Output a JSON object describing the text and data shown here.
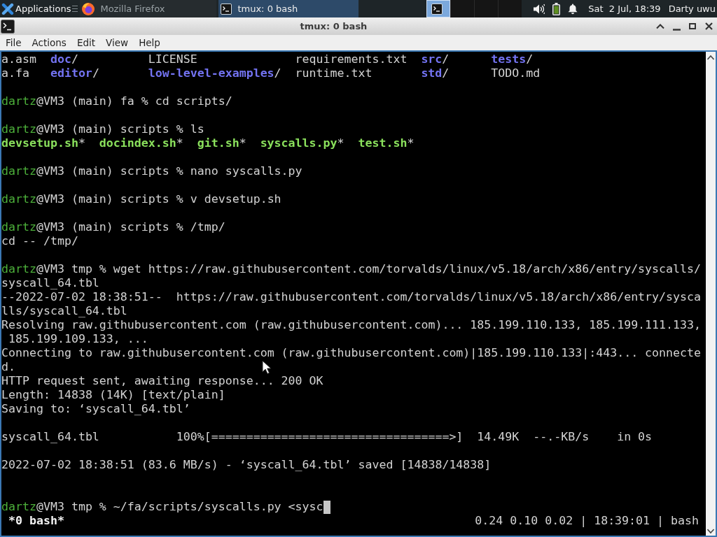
{
  "taskbar": {
    "app_menu": {
      "label": "Applications"
    },
    "tasks": [
      {
        "label": "Mozilla Firefox",
        "kind": "browser",
        "selected": false
      },
      {
        "label": "tmux: 0 bash",
        "kind": "terminal",
        "selected": true
      }
    ],
    "workspaces": [
      {
        "selected": true,
        "has_window": true
      },
      {
        "selected": false,
        "has_window": false
      },
      {
        "selected": false,
        "has_window": false
      },
      {
        "selected": false,
        "has_window": false
      }
    ],
    "clock": "Sat  2 Jul, 18:39",
    "user": "Darty uwu"
  },
  "window": {
    "title": "tmux: 0 bash",
    "menu": [
      "File",
      "Actions",
      "Edit",
      "View",
      "Help"
    ]
  },
  "terminal": {
    "lines": [
      {
        "kind": "listing",
        "rows": [
          [
            {
              "name": "a.asm",
              "kind": "file"
            },
            {
              "name": "doc",
              "kind": "dir",
              "suffix": "/"
            },
            {
              "name": "LICENSE",
              "kind": "file"
            },
            {
              "name": "requirements.txt",
              "kind": "file"
            },
            {
              "name": "src",
              "kind": "dir",
              "suffix": "/"
            },
            {
              "name": "tests",
              "kind": "dir",
              "suffix": "/"
            }
          ],
          [
            {
              "name": "a.fa",
              "kind": "file"
            },
            {
              "name": "editor",
              "kind": "dir",
              "suffix": "/"
            },
            {
              "name": "low-level-examples",
              "kind": "dir",
              "suffix": "/"
            },
            {
              "name": "runtime.txt",
              "kind": "file"
            },
            {
              "name": "std",
              "kind": "dir",
              "suffix": "/"
            },
            {
              "name": "TODO.md",
              "kind": "file"
            }
          ]
        ]
      },
      {
        "kind": "blank"
      },
      {
        "kind": "prompt",
        "user": "dartz",
        "text": "@VM3 (main) fa % cd scripts/"
      },
      {
        "kind": "blank"
      },
      {
        "kind": "prompt",
        "user": "dartz",
        "text": "@VM3 (main) scripts % ls"
      },
      {
        "kind": "listing",
        "rows": [
          [
            {
              "name": "devsetup.sh",
              "kind": "exec",
              "suffix": "*"
            },
            {
              "name": "docindex.sh",
              "kind": "exec",
              "suffix": "*"
            },
            {
              "name": "git.sh",
              "kind": "exec",
              "suffix": "*"
            },
            {
              "name": "syscalls.py",
              "kind": "exec",
              "suffix": "*"
            },
            {
              "name": "test.sh",
              "kind": "exec",
              "suffix": "*"
            }
          ]
        ]
      },
      {
        "kind": "blank"
      },
      {
        "kind": "prompt",
        "user": "dartz",
        "text": "@VM3 (main) scripts % nano syscalls.py"
      },
      {
        "kind": "blank"
      },
      {
        "kind": "prompt",
        "user": "dartz",
        "text": "@VM3 (main) scripts % v devsetup.sh"
      },
      {
        "kind": "blank"
      },
      {
        "kind": "prompt",
        "user": "dartz",
        "text": "@VM3 (main) scripts % /tmp/"
      },
      {
        "kind": "output",
        "text": "cd -- /tmp/"
      },
      {
        "kind": "blank"
      },
      {
        "kind": "prompt",
        "user": "dartz",
        "text": "@VM3 tmp % wget https://raw.githubusercontent.com/torvalds/linux/v5.18/arch/x86/entry/syscalls/"
      },
      {
        "kind": "output",
        "text": "syscall_64.tbl"
      },
      {
        "kind": "output",
        "text": "--2022-07-02 18:38:51--  https://raw.githubusercontent.com/torvalds/linux/v5.18/arch/x86/entry/sysca"
      },
      {
        "kind": "output",
        "text": "lls/syscall_64.tbl"
      },
      {
        "kind": "output",
        "text": "Resolving raw.githubusercontent.com (raw.githubusercontent.com)... 185.199.110.133, 185.199.111.133,"
      },
      {
        "kind": "output",
        "text": " 185.199.109.133, ..."
      },
      {
        "kind": "output",
        "text": "Connecting to raw.githubusercontent.com (raw.githubusercontent.com)|185.199.110.133|:443... connecte"
      },
      {
        "kind": "output",
        "text": "d."
      },
      {
        "kind": "output",
        "text": "HTTP request sent, awaiting response... 200 OK"
      },
      {
        "kind": "output",
        "text": "Length: 14838 (14K) [text/plain]"
      },
      {
        "kind": "output",
        "text": "Saving to: ‘syscall_64.tbl’"
      },
      {
        "kind": "blank"
      },
      {
        "kind": "output",
        "text": "syscall_64.tbl           100%[==================================>]  14.49K  --.-KB/s    in 0s"
      },
      {
        "kind": "blank"
      },
      {
        "kind": "output",
        "text": "2022-07-02 18:38:51 (83.6 MB/s) - ‘syscall_64.tbl’ saved [14838/14838]"
      },
      {
        "kind": "blank"
      },
      {
        "kind": "blank"
      },
      {
        "kind": "prompt",
        "user": "dartz",
        "text": "@VM3 tmp % ~/fa/scripts/syscalls.py <sysc",
        "cursor": true
      }
    ],
    "status_bar": {
      "window_tab": "*0 bash*",
      "info": "0.24 0.10 0.02 | 18:39:01 | bash"
    }
  }
}
